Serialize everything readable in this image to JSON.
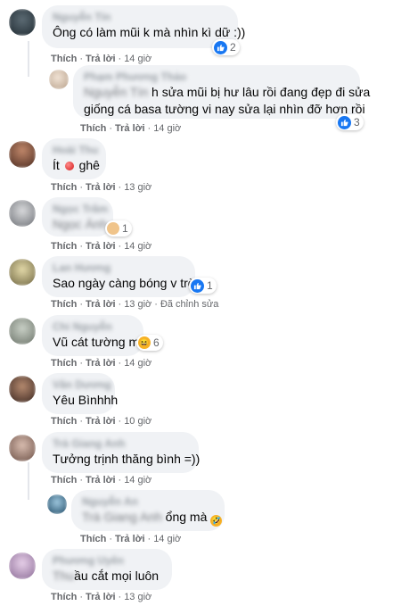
{
  "actions": {
    "like": "Thích",
    "reply": "Trả lời",
    "edited": "Đã chỉnh sửa"
  },
  "comments": [
    {
      "name": "Nguyễn Tín",
      "text": "Ông có làm mũi k mà nhìn kì dữ :))",
      "time": "14 giờ",
      "reaction": {
        "type": "like",
        "count": "2"
      },
      "avatar_color": "#2d3b44"
    },
    {
      "name": "Phạm Phương Thảo",
      "tag": "Nguyễn Tín",
      "text_line1": "h sửa mũi bị hư lâu rồi đang đẹp đi sửa",
      "text_line2": "giống cá basa tường vi nay sửa lại nhìn đỡ hơn rồi",
      "time": "14 giờ",
      "reaction": {
        "type": "like",
        "count": "3"
      },
      "avatar_color": "#d9c8b8"
    },
    {
      "name": "Hoài Thu",
      "text_pre": "Ít",
      "text_post": "ghê",
      "time": "13 giờ",
      "avatar_color": "#6b4a3a"
    },
    {
      "name": "Ngọc Trâm",
      "text": "Ngọc Ánh",
      "time": "14 giờ",
      "reaction": {
        "type": "emoji",
        "count": "1"
      },
      "avatar_color": "#8a8f96"
    },
    {
      "name": "Lan Hương",
      "text": "Sao ngày càng bóng v trời",
      "time": "13 giờ",
      "reaction": {
        "type": "like",
        "count": "1"
      },
      "avatar_color": "#a89a6a"
    },
    {
      "name": "Chi Nguyễn",
      "text": "Vũ cát tường mà",
      "time": "14 giờ",
      "reaction": {
        "type": "laugh",
        "count": "6"
      },
      "avatar_color": "#9aa39a"
    },
    {
      "name": "Vân Dương",
      "text": "Yêu Bìnhhh",
      "time": "10 giờ",
      "avatar_color": "#5a3f35"
    },
    {
      "name": "Trà Giang Anh",
      "text": "Tưởng trịnh thăng bình =))",
      "time": "14 giờ",
      "avatar_color": "#8c7468"
    },
    {
      "name": "Nguyễn An",
      "tag": "Trà Giang Anh",
      "text_post": "ổng mà",
      "time": "14 giờ",
      "avatar_color": "#3a6a8a"
    },
    {
      "name": "Phương Uyên",
      "text_pre": "Thu",
      "text": "ầu cắt mọi luôn",
      "time": "13 giờ",
      "avatar_color": "#c3a6cf"
    }
  ],
  "colors": {
    "bubble": "#f0f2f5",
    "like_blue": "#1877f2",
    "meta_gray": "#65676b"
  }
}
